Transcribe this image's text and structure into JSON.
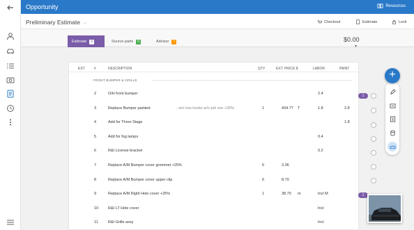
{
  "header": {
    "title": "Opportunity",
    "resources_label": "Resources"
  },
  "subheader": {
    "estimate_name": "Preliminary Estimate",
    "actions": [
      {
        "label": "Checkout"
      },
      {
        "label": "Estimate"
      },
      {
        "label": "Lock"
      }
    ]
  },
  "tabs": [
    {
      "label": "Estimate",
      "badge": "0",
      "badge_color": "#ffffff"
    },
    {
      "label": "Source parts",
      "badge": "0",
      "badge_color": "#4caf50"
    },
    {
      "label": "Advisor",
      "badge": "7",
      "badge_color": "#ff9800"
    }
  ],
  "total": "$0.00",
  "table": {
    "columns": [
      "EST",
      "#",
      "DESCRIPTION",
      "QTY",
      "EXT. PRICE $",
      "LABOR",
      "PAINT"
    ],
    "section": "FRONT BUMPER & GRILLE",
    "rows": [
      {
        "num": "2",
        "desc": "O/H front bumper",
        "desc_note": "",
        "qty": "",
        "price": "",
        "flag": "",
        "labor": "2.4",
        "paint": ""
      },
      {
        "num": "3",
        "desc": "Replace Bumper painted",
        "desc_note": ", w/o tow hooks w/o prk sns +25%",
        "qty": "1",
        "price": "434.77",
        "flag": "T",
        "labor": "1.8",
        "paint": "2.8"
      },
      {
        "num": "4",
        "desc": "Add for Three Stage",
        "desc_note": "",
        "qty": "",
        "price": "",
        "flag": "",
        "labor": "",
        "paint": "1.8"
      },
      {
        "num": "5",
        "desc": "Add for fog lamps",
        "desc_note": "",
        "qty": "",
        "price": "",
        "flag": "",
        "labor": "0.4",
        "paint": ""
      },
      {
        "num": "6",
        "desc": "R&I License bracket",
        "desc_note": "",
        "qty": "",
        "price": "",
        "flag": "",
        "labor": "0.2",
        "paint": ""
      },
      {
        "num": "7",
        "desc": "Replace A/M Bumper cover grommet +25%",
        "desc_note": "",
        "qty": "6",
        "price": "3.36",
        "flag": "",
        "labor": "",
        "paint": ""
      },
      {
        "num": "8",
        "desc": "Replace A/M Bumper cover upper clip",
        "desc_note": "",
        "qty": "6",
        "price": "8.70",
        "flag": "",
        "labor": "",
        "paint": ""
      },
      {
        "num": "9",
        "desc": "Replace A/M Right Hole cover +25%",
        "desc_note": "",
        "qty": "1",
        "price": "38.70",
        "flag": "m",
        "labor": "Incl  M",
        "paint": ""
      },
      {
        "num": "10",
        "desc": "R&I LT Hole cover",
        "desc_note": "",
        "qty": "",
        "price": "",
        "flag": "",
        "labor": "Incl",
        "paint": ""
      },
      {
        "num": "11",
        "desc": "R&I Grille assy",
        "desc_note": "",
        "qty": "",
        "price": "",
        "flag": "",
        "labor": "Incl",
        "paint": ""
      }
    ]
  },
  "side_markers": [
    {
      "label": "1"
    },
    {
      "label": "1"
    }
  ],
  "fab_label": "+",
  "tools": [
    "pencil-icon",
    "note-icon",
    "dollar-icon",
    "database-icon",
    "car-icon"
  ]
}
